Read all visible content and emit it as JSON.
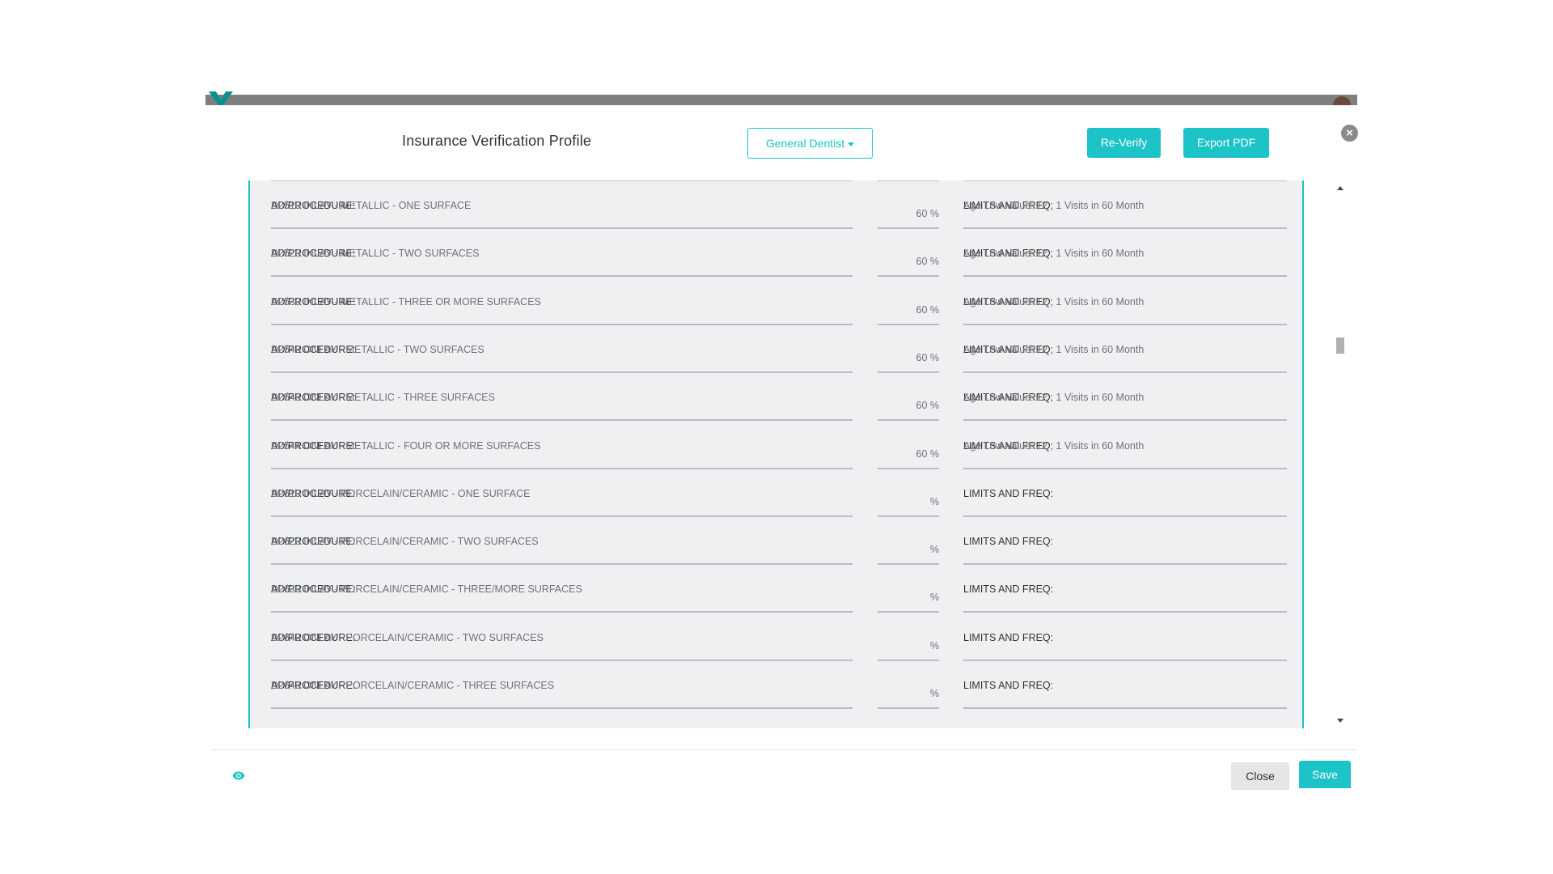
{
  "header": {
    "title": "Insurance Verification Profile",
    "provider_select": "General Dentist",
    "reverify_label": "Re-Verify",
    "export_label": "Export PDF",
    "close_icon": "close-circle-icon"
  },
  "rows": [
    {
      "proc_label": "AD/PROCEDURE:",
      "proc_value": "D2510 INLAY - METALLIC - ONE SURFACE",
      "pct": "60 %",
      "limit_label": "LIMITS AND FREQ:",
      "limit_value": "Age Low Value: 12 ; 1 Visits in 60 Month"
    },
    {
      "proc_label": "AD/PROCEDURE:",
      "proc_value": "D2520 INLAY - METALLIC - TWO SURFACES",
      "pct": "60 %",
      "limit_label": "LIMITS AND FREQ:",
      "limit_value": "Age Low Value: 12 ; 1 Visits in 60 Month"
    },
    {
      "proc_label": "AD/PROCEDURE:",
      "proc_value": "D2530 INLAY - METALLIC - THREE OR MORE SURFACES",
      "pct": "60 %",
      "limit_label": "LIMITS AND FREQ:",
      "limit_value": "Age Low Value: 12 ; 1 Visits in 60 Month"
    },
    {
      "proc_label": "AD/PROCEDURE:",
      "proc_value": "D2542 ONLAY - METALLIC - TWO SURFACES",
      "pct": "60 %",
      "limit_label": "LIMITS AND FREQ:",
      "limit_value": "Age Low Value: 12 ; 1 Visits in 60 Month"
    },
    {
      "proc_label": "AD/PROCEDURE:",
      "proc_value": "D2543 ONLAY - METALLIC - THREE SURFACES",
      "pct": "60 %",
      "limit_label": "LIMITS AND FREQ:",
      "limit_value": "Age Low Value: 12 ; 1 Visits in 60 Month"
    },
    {
      "proc_label": "AD/PROCEDURE:",
      "proc_value": "D2544 ONLAY - METALLIC - FOUR OR MORE SURFACES",
      "pct": "60 %",
      "limit_label": "LIMITS AND FREQ:",
      "limit_value": "Age Low Value: 12 ; 1 Visits in 60 Month"
    },
    {
      "proc_label": "AD/PROCEDURE:",
      "proc_value": "D2610 INLAY - PORCELAIN/CERAMIC - ONE SURFACE",
      "pct": "%",
      "limit_label": "LIMITS AND FREQ:",
      "limit_value": ""
    },
    {
      "proc_label": "AD/PROCEDURE:",
      "proc_value": "D2620 INLAY - PORCELAIN/CERAMIC - TWO SURFACES",
      "pct": "%",
      "limit_label": "LIMITS AND FREQ:",
      "limit_value": ""
    },
    {
      "proc_label": "AD/PROCEDURE:",
      "proc_value": "D2630 INLAY - PORCELAIN/CERAMIC - THREE/MORE SURFACES",
      "pct": "%",
      "limit_label": "LIMITS AND FREQ:",
      "limit_value": ""
    },
    {
      "proc_label": "AD/PROCEDURE:",
      "proc_value": "D2642 ONLAY - PORCELAIN/CERAMIC - TWO SURFACES",
      "pct": "%",
      "limit_label": "LIMITS AND FREQ:",
      "limit_value": ""
    },
    {
      "proc_label": "AD/PROCEDURE:",
      "proc_value": "D2643 ONLAY - PORCELAIN/CERAMIC - THREE SURFACES",
      "pct": "%",
      "limit_label": "LIMITS AND FREQ:",
      "limit_value": ""
    }
  ],
  "footer": {
    "eye_icon": "eye-icon",
    "close_label": "Close",
    "save_label": "Save"
  },
  "colors": {
    "accent": "#1cc3c7",
    "panel_bg": "#eff0f1",
    "text_dark": "#333333",
    "text_muted": "#6e7378"
  }
}
